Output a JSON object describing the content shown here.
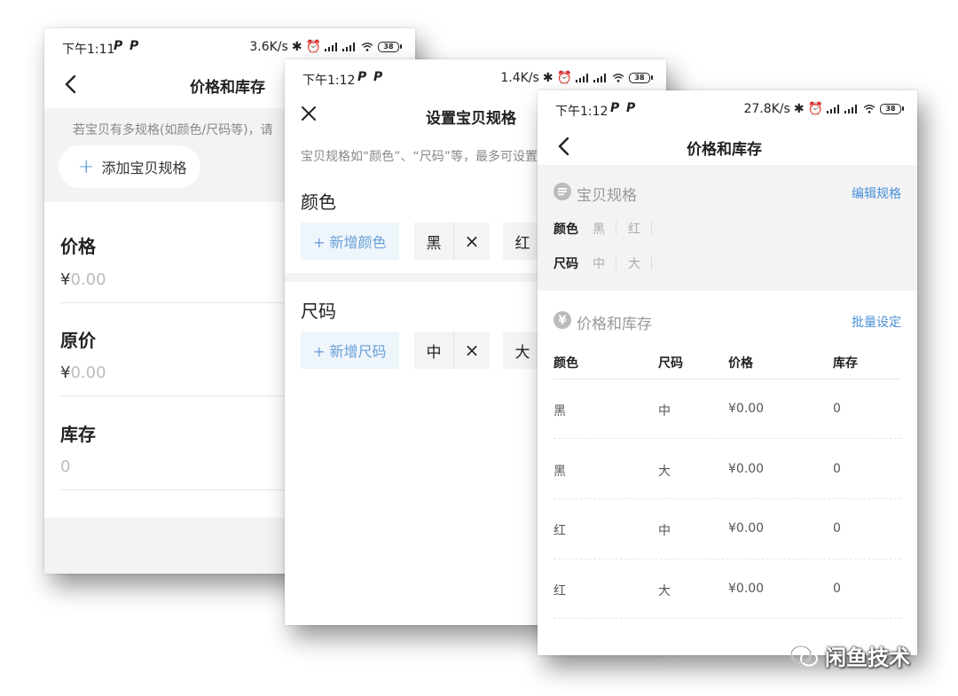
{
  "screen1": {
    "status": {
      "time": "下午1:11",
      "p1": "P",
      "p2": "P",
      "speed": "3.6K/s",
      "battery": "38"
    },
    "title": "价格和库存",
    "hint": "若宝贝有多规格(如颜色/尺码等)，请",
    "add_spec": "添加宝贝规格",
    "price_label": "价格",
    "price_placeholder": "0.00",
    "orig_label": "原价",
    "orig_placeholder": "0.00",
    "stock_label": "库存",
    "stock_placeholder": "0",
    "currency": "¥"
  },
  "screen2": {
    "status": {
      "time": "下午1:12",
      "p1": "P",
      "p2": "P",
      "speed": "1.4K/s",
      "battery": "38"
    },
    "title": "设置宝贝规格",
    "hint": "宝贝规格如“颜色”、“尺码”等，最多可设置",
    "color_label": "颜色",
    "add_color": "+ 新增颜色",
    "color_tag_1": "黑",
    "color_tag_2": "红",
    "size_label": "尺码",
    "add_size": "+ 新增尺码",
    "size_tag_1": "中",
    "size_tag_2": "大",
    "remove": "×"
  },
  "screen3": {
    "status": {
      "time": "下午1:12",
      "p1": "P",
      "p2": "P",
      "speed": "27.8K/s",
      "battery": "38"
    },
    "title": "价格和库存",
    "spec_section": "宝贝规格",
    "edit_spec": "编辑规格",
    "color_key": "颜色",
    "color_values": [
      "黑",
      "红"
    ],
    "size_key": "尺码",
    "size_values": [
      "中",
      "大"
    ],
    "price_section": "价格和库存",
    "batch_set": "批量设定",
    "table_headers": [
      "颜色",
      "尺码",
      "价格",
      "库存"
    ],
    "rows": [
      [
        "黑",
        "中",
        "¥0.00",
        "0"
      ],
      [
        "黑",
        "大",
        "¥0.00",
        "0"
      ],
      [
        "红",
        "中",
        "¥0.00",
        "0"
      ],
      [
        "红",
        "大",
        "¥0.00",
        "0"
      ]
    ]
  },
  "watermark": "闲鱼技术"
}
